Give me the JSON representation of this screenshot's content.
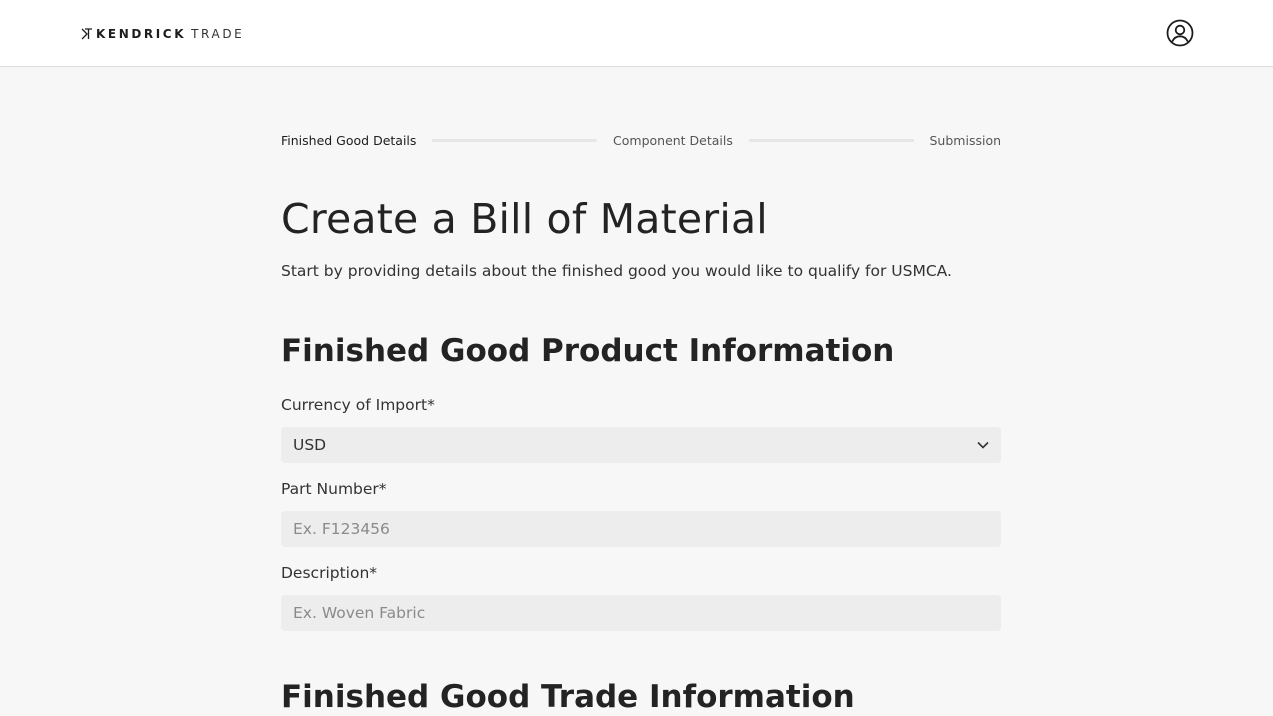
{
  "header": {
    "logo_bold": "KENDRICK",
    "logo_light": "TRADE",
    "account_icon": "user-circle-icon"
  },
  "stepper": {
    "steps": [
      {
        "label": "Finished Good Details",
        "active": true
      },
      {
        "label": "Component Details",
        "active": false
      },
      {
        "label": "Submission",
        "active": false
      }
    ]
  },
  "page": {
    "title": "Create a Bill of Material",
    "subtitle": "Start by providing details about the finished good you would like to qualify for USMCA."
  },
  "product_info": {
    "heading": "Finished Good Product Information",
    "currency": {
      "label": "Currency of Import*",
      "value": "USD",
      "icon": "chevron-down-icon"
    },
    "part_number": {
      "label": "Part Number*",
      "placeholder": "Ex. F123456",
      "value": ""
    },
    "description": {
      "label": "Description*",
      "placeholder": "Ex. Woven Fabric",
      "value": ""
    }
  },
  "trade_info": {
    "heading": "Finished Good Trade Information"
  }
}
